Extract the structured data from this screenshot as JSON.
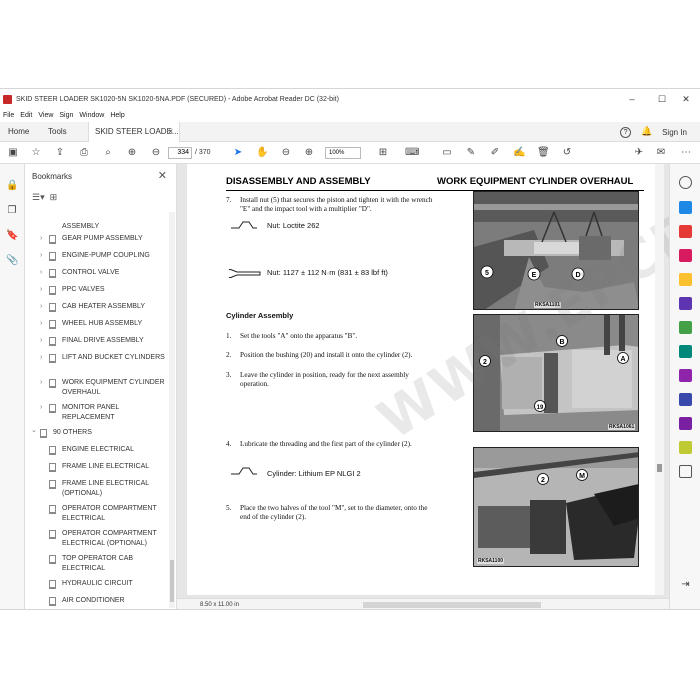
{
  "window": {
    "title": "SKID STEER LOADER SK1020-5N SK1020-5NA.PDF (SECURED) - Adobe Acrobat Reader DC (32-bit)",
    "minimize": "–",
    "maximize": "☐",
    "close": "✕"
  },
  "menu": [
    "File",
    "Edit",
    "View",
    "Sign",
    "Window",
    "Help"
  ],
  "tabs": {
    "home": "Home",
    "tools": "Tools",
    "document": "SKID STEER LOADE...",
    "document_close": "×",
    "help_icon": "?",
    "sign_in": "Sign In"
  },
  "toolbar": {
    "current_page": "334",
    "total_pages": "/ 370",
    "zoom": "100%"
  },
  "bookmarks": {
    "title": "Bookmarks",
    "close": "✕",
    "items": [
      {
        "label": "ASSEMBLY",
        "kind": "cont"
      },
      {
        "label": "GEAR PUMP ASSEMBLY",
        "kind": "child"
      },
      {
        "label": "ENGINE-PUMP COUPLING",
        "kind": "child"
      },
      {
        "label": "CONTROL VALVE",
        "kind": "child"
      },
      {
        "label": "PPC VALVES",
        "kind": "child"
      },
      {
        "label": "CAB HEATER ASSEMBLY",
        "kind": "child"
      },
      {
        "label": "WHEEL HUB ASSEMBLY",
        "kind": "child"
      },
      {
        "label": "FINAL DRIVE ASSEMBLY",
        "kind": "child"
      },
      {
        "label": "LIFT AND BUCKET CYLINDERS",
        "kind": "child"
      },
      {
        "label": "WORK EQUIPMENT CYLINDER OVERHAUL",
        "kind": "child"
      },
      {
        "label": "MONITOR PANEL REPLACEMENT",
        "kind": "child"
      },
      {
        "label": "90 OTHERS",
        "kind": "section"
      },
      {
        "label": "ENGINE ELECTRICAL",
        "kind": "leaf"
      },
      {
        "label": "FRAME LINE ELECTRICAL",
        "kind": "leaf"
      },
      {
        "label": "FRAME LINE ELECTRICAL (OPTIONAL)",
        "kind": "leaf"
      },
      {
        "label": "OPERATOR COMPARTMENT ELECTRICAL",
        "kind": "leaf"
      },
      {
        "label": "OPERATOR COMPARTMENT ELECTRICAL (OPTIONAL)",
        "kind": "leaf"
      },
      {
        "label": "TOP OPERATOR CAB ELECTRICAL",
        "kind": "leaf"
      },
      {
        "label": "HYDRAULIC CIRCUIT",
        "kind": "leaf"
      },
      {
        "label": "AIR CONDITIONER",
        "kind": "leaf"
      }
    ]
  },
  "status": {
    "page_size": "8.50 x 11.00 in"
  },
  "page": {
    "header_left": "DISASSEMBLY AND ASSEMBLY",
    "header_right": "WORK EQUIPMENT CYLINDER OVERHAUL",
    "step7_num": "7.",
    "step7_line1": "Install nut (5) that secures the piston and tighten it with the wrench",
    "step7_line2": "\"E\" and the impact tool with a multiplier \"D\".",
    "nut_loctite": "Nut: Loctite 262",
    "nut_torque": "Nut: 1127 ± 112 N·m (831 ± 83 lbf ft)",
    "cylinder_assembly": "Cylinder Assembly",
    "step1_num": "1.",
    "step1": "Set the tools \"A\" onto the apparatus \"B\".",
    "step2_num": "2.",
    "step2": "Position the bushing (20) and install it onto the cylinder (2).",
    "step3_num": "3.",
    "step3_line1": "Leave the cylinder in position, ready for the next assembly",
    "step3_line2": "operation.",
    "step4_num": "4.",
    "step4": "Lubricate the threading and the first part of the cylinder (2).",
    "lube": "Cylinder: Lithium EP NLGI 2",
    "step5_num": "5.",
    "step5_line1": "Place the two halves of the tool \"M\", set to the diameter, onto the",
    "step5_line2": "end of the cylinder (2).",
    "fig1_caption": "RKSA1101",
    "fig2_caption": "RKSA1061",
    "fig3_caption": "RKSA1100",
    "fig1_labels": [
      "5",
      "E",
      "D"
    ],
    "fig2_labels": [
      "B",
      "2",
      "A",
      "19"
    ],
    "fig3_labels": [
      "2",
      "M"
    ]
  },
  "watermark": "WWW.EPCDEPOT.COM"
}
